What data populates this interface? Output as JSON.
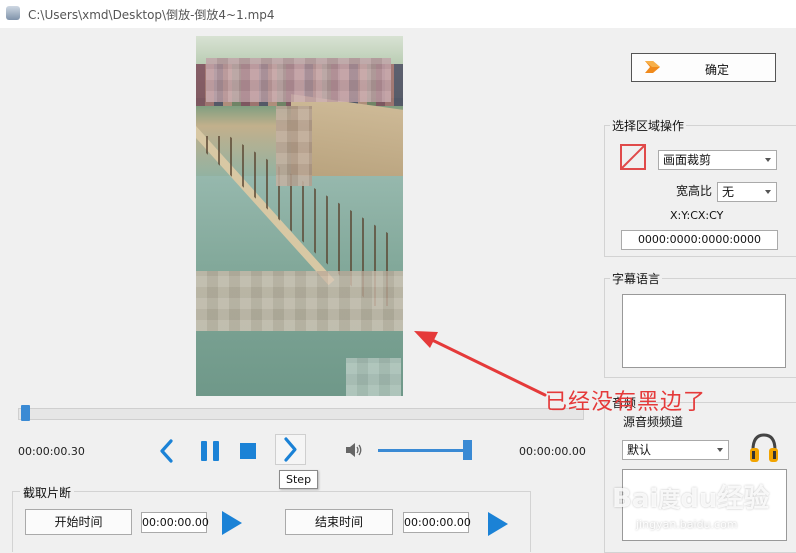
{
  "window": {
    "title": "C:\\Users\\xmd\\Desktop\\倒放-倒放4~1.mp4"
  },
  "player": {
    "current_time": "00:00:00.30",
    "total_time": "00:00:00.00",
    "progress_fraction": 0.01,
    "volume_fraction": 0.9,
    "tooltip": "Step"
  },
  "clip": {
    "group_label": "截取片断",
    "start_label": "开始时间",
    "start_value": "00:00:00.00",
    "end_label": "结束时间",
    "end_value": "00:00:00.00"
  },
  "right_panel": {
    "confirm_label": "确定",
    "region": {
      "group_label": "选择区域操作",
      "crop_option": "画面裁剪",
      "ratio_label": "宽高比",
      "ratio_option": "无",
      "coord_caption": "X:Y:CX:CY",
      "coord_value": "0000:0000:0000:0000"
    },
    "subtitle": {
      "group_label": "字幕语言"
    },
    "audio": {
      "group_label": "音频",
      "source_label": "源音频频道",
      "source_option": "默认"
    }
  },
  "annotation": {
    "text": "已经没有黑边了",
    "color": "#e53a3a"
  },
  "watermark": {
    "text": "Baidu经验",
    "sub": "jingyan.baidu.com"
  },
  "icons": [
    "app-icon",
    "prev-icon",
    "pause-icon",
    "stop-icon",
    "next-icon",
    "volume-icon",
    "play-icon",
    "confirm-arrow-icon",
    "crop-icon",
    "headphone-icon"
  ],
  "colors": {
    "accent": "#1b82d6",
    "annotation": "#e53a3a"
  }
}
